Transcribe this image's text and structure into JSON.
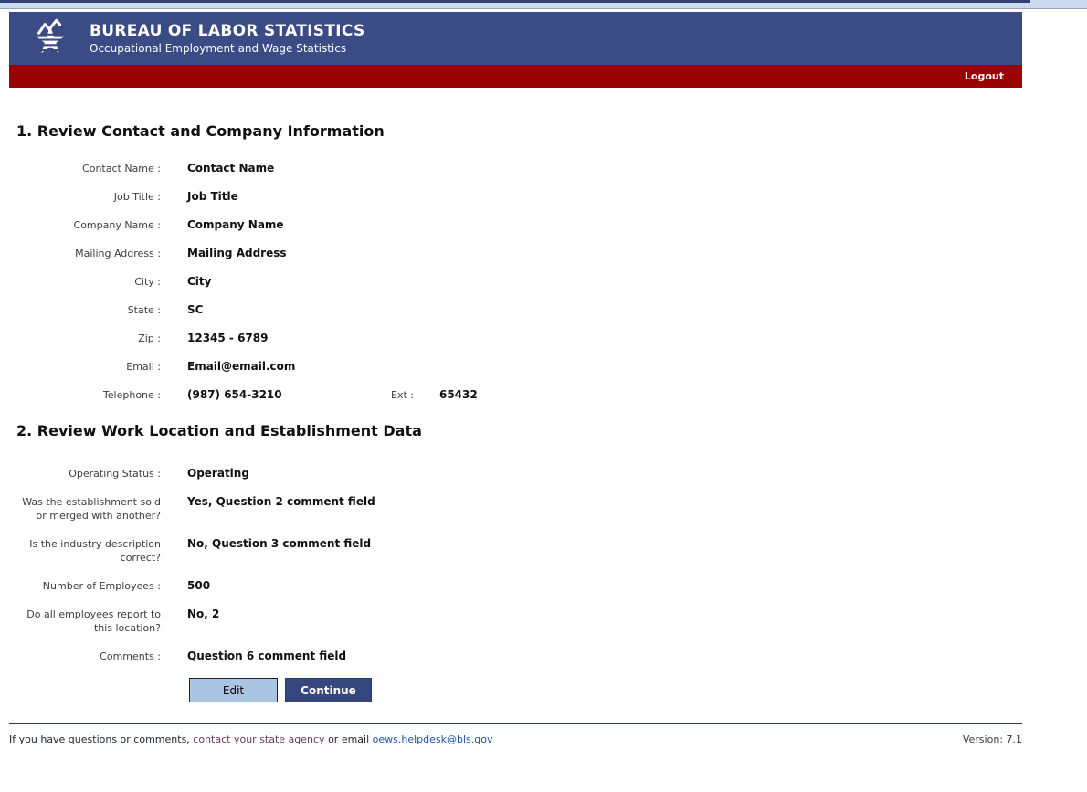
{
  "header": {
    "title": "BUREAU OF LABOR STATISTICS",
    "subtitle": "Occupational Employment and Wage Statistics",
    "logout_label": "Logout",
    "logo_icon": "bls-star-chart-logo"
  },
  "sections": [
    {
      "heading": "1. Review Contact and Company Information",
      "rows": [
        {
          "label": "Contact Name :",
          "value": "Contact Name"
        },
        {
          "label": "Job Title :",
          "value": "Job Title"
        },
        {
          "label": "Company Name :",
          "value": "Company Name"
        },
        {
          "label": "Mailing Address :",
          "value": "Mailing Address"
        },
        {
          "label": "City :",
          "value": "City"
        },
        {
          "label": "State :",
          "value": "SC"
        },
        {
          "label": "Zip :",
          "value": "12345 - 6789"
        },
        {
          "label": "Email :",
          "value": "Email@email.com"
        },
        {
          "label": "Telephone :",
          "value": "(987) 654-3210",
          "ext_label": "Ext :",
          "ext_value": "65432"
        }
      ]
    },
    {
      "heading": "2. Review Work Location and Establishment Data",
      "rows": [
        {
          "label": "Operating Status :",
          "value": "Operating"
        },
        {
          "label": "Was the establishment sold or merged with another?",
          "value": "Yes, Question 2 comment field"
        },
        {
          "label": "Is the industry description correct?",
          "value": "No, Question 3 comment field"
        },
        {
          "label": "Number of Employees :",
          "value": "500"
        },
        {
          "label": "Do all employees report to this location?",
          "value": "No, 2"
        },
        {
          "label": "Comments :",
          "value": "Question 6 comment field"
        }
      ]
    }
  ],
  "buttons": {
    "edit_label": "Edit",
    "continue_label": "Continue"
  },
  "footer": {
    "text_prefix": "If you have questions or comments, ",
    "link_state_agency": "contact your state agency",
    "text_middle": " or email ",
    "link_email": "oews.helpdesk@bls.gov",
    "version": "Version: 7.1"
  },
  "colors": {
    "header_navy": "#3b4b86",
    "bar_red": "#9a0202",
    "continue_button_navy": "#35477d",
    "edit_button_light_blue": "#aac4e1",
    "top_strip_light_blue": "#cbd9f1",
    "visited_link": "#6e3c55",
    "email_link_blue": "#2052a3"
  }
}
